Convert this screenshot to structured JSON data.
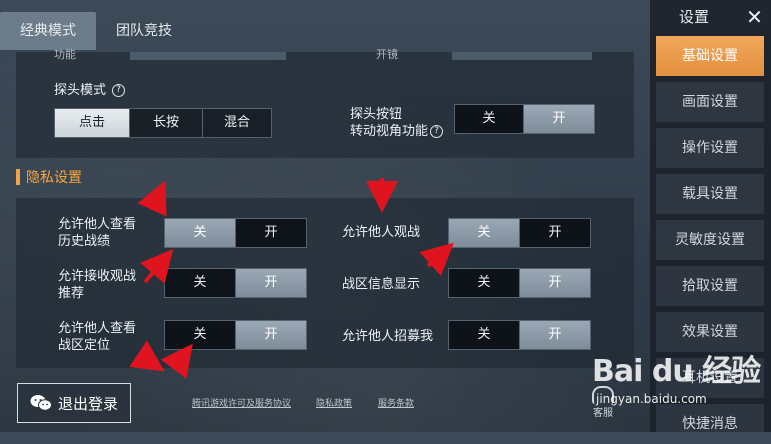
{
  "tabs": [
    {
      "label": "经典模式"
    },
    {
      "label": "团队竞技"
    }
  ],
  "top_section": {
    "cut_left": "功能",
    "cut_right": "开镜",
    "peek_mode": {
      "label": "探头模式",
      "help": "?",
      "options": [
        "点击",
        "长按",
        "混合"
      ],
      "selected": "点击"
    },
    "peek_button": {
      "label_line1": "探头按钮",
      "label_line2": "转动视角功能",
      "help": "?",
      "options": [
        "关",
        "开"
      ],
      "selected": "开"
    }
  },
  "privacy": {
    "section_title": "隐私设置",
    "rows": [
      {
        "label_line1": "允许他人查看",
        "label_line2": "历史战绩",
        "options": [
          "关",
          "开"
        ],
        "selected": "关"
      },
      {
        "label_line1": "允许他人观战",
        "label_line2": "",
        "options": [
          "关",
          "开"
        ],
        "selected": "关"
      },
      {
        "label_line1": "允许接收观战",
        "label_line2": "推荐",
        "options": [
          "关",
          "开"
        ],
        "selected": "开"
      },
      {
        "label_line1": "战区信息显示",
        "label_line2": "",
        "options": [
          "关",
          "开"
        ],
        "selected": "开"
      },
      {
        "label_line1": "允许他人查看",
        "label_line2": "战区定位",
        "options": [
          "关",
          "开"
        ],
        "selected": "开"
      },
      {
        "label_line1": "允许他人招募我",
        "label_line2": "",
        "options": [
          "关",
          "开"
        ],
        "selected": "开"
      }
    ]
  },
  "sidebar": {
    "title": "设置",
    "close": "✕",
    "items": [
      {
        "label": "基础设置"
      },
      {
        "label": "画面设置"
      },
      {
        "label": "操作设置"
      },
      {
        "label": "载具设置"
      },
      {
        "label": "灵敏度设置"
      },
      {
        "label": "拾取设置"
      },
      {
        "label": "效果设置"
      },
      {
        "label": "耳机设置"
      },
      {
        "label": "快捷消息"
      }
    ]
  },
  "footer": {
    "logout": "退出登录",
    "links": [
      "腾讯游戏许可及服务协议",
      "隐私政策",
      "服务条款"
    ],
    "service": "客服"
  },
  "watermark": {
    "brand": "Bai du 经验",
    "url": "jingyan.baidu.com"
  },
  "colors": {
    "accent": "#f0a75a",
    "arrow": "#e0141e"
  }
}
